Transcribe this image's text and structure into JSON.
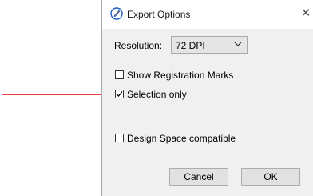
{
  "dialog": {
    "title": "Export Options",
    "icon": "pen-nib-icon",
    "close_glyph": "✕"
  },
  "resolution": {
    "label": "Resolution:",
    "value": "72 DPI"
  },
  "options": [
    {
      "label": "Show Registration Marks",
      "checked": false
    },
    {
      "label": "Selection only",
      "checked": true
    },
    {
      "label": "Design Space compatible",
      "checked": false
    }
  ],
  "buttons": {
    "cancel": "Cancel",
    "ok": "OK"
  },
  "colors": {
    "annotation_arrow": "#e00000",
    "icon_accent": "#1f5fbf"
  }
}
